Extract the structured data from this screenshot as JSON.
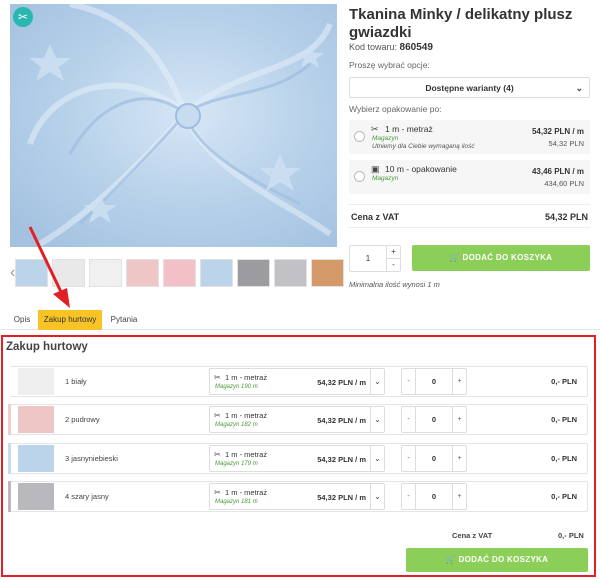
{
  "product": {
    "title": "Tkanina Minky / delikatny plusz gwiazdki",
    "code_label": "Kod towaru:",
    "code_value": "860549"
  },
  "options": {
    "choose_label": "Proszę wybrać opcje:",
    "variant_value": "Dostępne warianty (4)",
    "packaging_label": "Wybierz opakowanie po:",
    "packages": [
      {
        "label": "1 m - metraż",
        "stock": "Magazyn",
        "note": "Utniemy dla Ciebie wymaganą ilość",
        "price": "54,32 PLN / m",
        "subprice": "54,32 PLN"
      },
      {
        "label": "10 m - opakowanie",
        "stock": "Magazyn",
        "note": "",
        "price": "43,46 PLN / m",
        "subprice": "434,60 PLN"
      }
    ],
    "vat_label": "Cena z VAT",
    "vat_value": "54,32 PLN",
    "qty_value": "1",
    "qty_plus": "+",
    "qty_minus": "-",
    "add_to_cart": "DODAĆ DO KOSZYKA",
    "min_note": "Minimalna ilość wynosi 1 m"
  },
  "tabs": [
    {
      "label": "Opis",
      "active": false
    },
    {
      "label": "Zakup hurtowy",
      "active": true
    },
    {
      "label": "Pytania",
      "active": false
    }
  ],
  "wholesale": {
    "title": "Zakup hurtowy",
    "rows": [
      {
        "name": "1 biały",
        "swatch": "#efefef",
        "strip": "#ffffff",
        "pack": "1 m - metraż",
        "stock": "Magazyn 190 m",
        "price": "54,32 PLN / m",
        "qty": "0",
        "total": "0,- PLN"
      },
      {
        "name": "2 pudrowy",
        "swatch": "#efc6c6",
        "strip": "#f1cccc",
        "pack": "1 m - metraż",
        "stock": "Magazyn 182 m",
        "price": "54,32 PLN / m",
        "qty": "0",
        "total": "0,- PLN"
      },
      {
        "name": "3 jasnyniebieski",
        "swatch": "#bcd4ea",
        "strip": "#c6dbef",
        "pack": "1 m - metraż",
        "stock": "Magazyn 179 m",
        "price": "54,32 PLN / m",
        "qty": "0",
        "total": "0,- PLN"
      },
      {
        "name": "4 szary jasny",
        "swatch": "#b9b9bd",
        "strip": "#b9b9bd",
        "pack": "1 m - metraż",
        "stock": "Magazyn 181 m",
        "price": "54,32 PLN / m",
        "qty": "0",
        "total": "0,- PLN"
      }
    ],
    "minus": "-",
    "plus": "+",
    "vat_label": "Cena z VAT",
    "vat_value": "0,- PLN",
    "add_to_cart": "DODAĆ DO KOSZYKA"
  },
  "thumbnails": [
    "#bcd4ea",
    "#e9e9e9",
    "#f0f0f0",
    "#efc6c6",
    "#f3c0c8",
    "#bcd4ea",
    "#9b9ba0",
    "#c2c2c6",
    "#d59a6a"
  ],
  "icons": {
    "badge": "scissors-icon",
    "cart": "cart-icon",
    "box": "box-icon",
    "chevron": "chevron-down-icon"
  },
  "colors": {
    "accent_green": "#8ccf58",
    "tab_active": "#f7c325",
    "highlight_red": "#e11f25"
  }
}
